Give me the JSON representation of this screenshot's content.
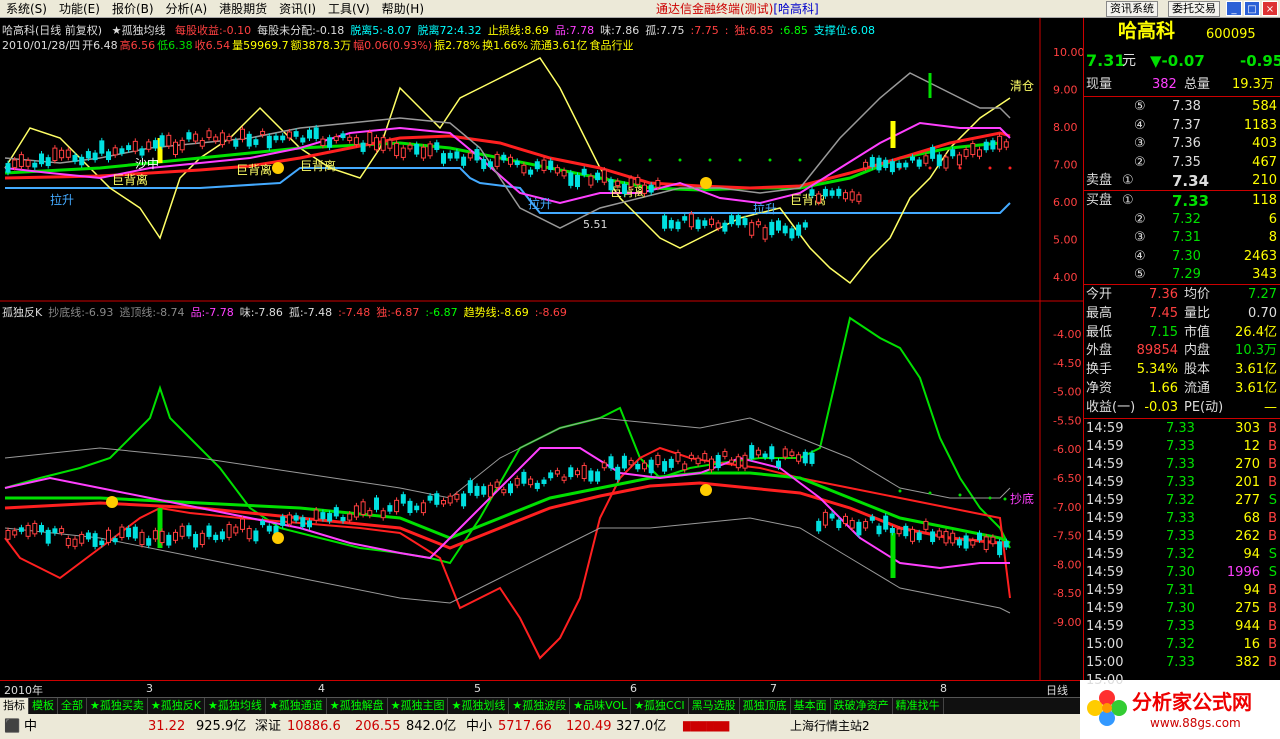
{
  "menu": {
    "items": [
      "系统(S)",
      "功能(E)",
      "报价(B)",
      "分析(A)",
      "港股期货",
      "资讯(I)",
      "工具(V)",
      "帮助(H)"
    ],
    "app_title": "通达信金融终端(测试)",
    "stock_title": "[哈高科]",
    "right_buttons": [
      "资讯系统",
      "委托交易"
    ],
    "window_buttons": [
      "_",
      "□",
      "×"
    ]
  },
  "top_chart": {
    "header": {
      "name": "哈高科(日线 前复权)",
      "indicator": "★孤独均线",
      "items": [
        {
          "text": "每股收益:-0.10",
          "color": "#ff4040"
        },
        {
          "text": "每股未分配:-0.18",
          "color": "#ddd"
        },
        {
          "text": "脱离5:-8.07",
          "color": "#00ffff"
        },
        {
          "text": "脱离72:4.32",
          "color": "#00ffff"
        },
        {
          "text": "止损线:8.69",
          "color": "#ffff00"
        },
        {
          "text": "品:7.78",
          "color": "#ff40ff"
        },
        {
          "text": "味:7.86",
          "color": "#ddd"
        },
        {
          "text": "孤:7.75",
          "color": "#ddd"
        },
        {
          "text": ":7.75",
          "color": "#ff4040"
        },
        {
          "text": ":",
          "color": "#ff4040"
        },
        {
          "text": "独:6.85",
          "color": "#ff4040"
        },
        {
          "text": ":6.85",
          "color": "#00ff00"
        },
        {
          "text": "支撑位:6.08",
          "color": "#00ffff"
        }
      ],
      "line2": [
        {
          "text": "2010/01/28/四",
          "color": "#ddd"
        },
        {
          "text": "开6.48",
          "color": "#ddd"
        },
        {
          "text": "高6.56",
          "color": "#ff4040"
        },
        {
          "text": "低6.38",
          "color": "#00e000"
        },
        {
          "text": "收6.54",
          "color": "#ff4040"
        },
        {
          "text": "量59969.7",
          "color": "#ffff00"
        },
        {
          "text": "额3878.3万",
          "color": "#ffff00"
        },
        {
          "text": "幅0.06(0.93%)",
          "color": "#ff4040"
        },
        {
          "text": "振2.78%",
          "color": "#ffff00"
        },
        {
          "text": "换1.66%",
          "color": "#ffff00"
        },
        {
          "text": "流通3.61亿",
          "color": "#ffff00"
        },
        {
          "text": "食品行业",
          "color": "#ffff00"
        }
      ]
    },
    "yaxis": [
      "10.00",
      "9.00",
      "8.00",
      "7.00",
      "6.00",
      "5.00",
      "4.00"
    ],
    "annotations": [
      "拉升",
      "沙中",
      "巨背离",
      "巨背离",
      "巨背离",
      "拉升",
      "巨背离",
      "巨背离",
      "拉升",
      "清仓",
      "5.51"
    ]
  },
  "bottom_chart": {
    "header": [
      {
        "text": "孤独反K",
        "color": "#ddd"
      },
      {
        "text": "抄底线:-6.93",
        "color": "#888"
      },
      {
        "text": "逃顶线:-8.74",
        "color": "#888"
      },
      {
        "text": "品:-7.78",
        "color": "#ff40ff"
      },
      {
        "text": "味:-7.86",
        "color": "#ddd"
      },
      {
        "text": "孤:-7.48",
        "color": "#ddd"
      },
      {
        "text": ":-7.48",
        "color": "#ff4040"
      },
      {
        "text": "独:-6.87",
        "color": "#ff4040"
      },
      {
        "text": ":-6.87",
        "color": "#00ff00"
      },
      {
        "text": "趋势线:-8.69",
        "color": "#ffff00"
      },
      {
        "text": ":-8.69",
        "color": "#ff4040"
      }
    ],
    "yaxis": [
      "-4.00",
      "-4.50",
      "-5.00",
      "-5.50",
      "-6.00",
      "-6.50",
      "-7.00",
      "-7.50",
      "-8.00",
      "-8.50",
      "-9.00"
    ],
    "annotations": [
      "抄底"
    ]
  },
  "xaxis": {
    "labels": [
      "2010年",
      "3",
      "4",
      "5",
      "6",
      "7",
      "8"
    ],
    "period": "日线"
  },
  "quote": {
    "name": "哈高科",
    "code": "600095",
    "price": "7.31",
    "unit": "元",
    "change": "▼-0.07",
    "change_pct": "-0.95",
    "now_vol_label": "现量",
    "now_vol": "382",
    "total_vol_label": "总量",
    "total_vol": "19.3万",
    "sells": [
      {
        "idx": "⑤",
        "price": "7.38",
        "vol": "584"
      },
      {
        "idx": "④",
        "price": "7.37",
        "vol": "1183"
      },
      {
        "idx": "③",
        "price": "7.36",
        "vol": "403"
      },
      {
        "idx": "②",
        "price": "7.35",
        "vol": "467"
      },
      {
        "idx": "①",
        "price": "7.34",
        "vol": "210",
        "label": "卖盘"
      }
    ],
    "buys": [
      {
        "idx": "①",
        "price": "7.33",
        "vol": "118",
        "label": "买盘"
      },
      {
        "idx": "②",
        "price": "7.32",
        "vol": "6"
      },
      {
        "idx": "③",
        "price": "7.31",
        "vol": "8"
      },
      {
        "idx": "④",
        "price": "7.30",
        "vol": "2463"
      },
      {
        "idx": "⑤",
        "price": "7.29",
        "vol": "343"
      }
    ],
    "stats": [
      {
        "l1": "今开",
        "v1": "7.36",
        "c1": "#ff4040",
        "l2": "均价",
        "v2": "7.27",
        "c2": "#00e000"
      },
      {
        "l1": "最高",
        "v1": "7.45",
        "c1": "#ff4040",
        "l2": "量比",
        "v2": "0.70",
        "c2": "#ddd"
      },
      {
        "l1": "最低",
        "v1": "7.15",
        "c1": "#00e000",
        "l2": "市值",
        "v2": "26.4亿",
        "c2": "#ffff00"
      },
      {
        "l1": "外盘",
        "v1": "89854",
        "c1": "#ff4040",
        "l2": "内盘",
        "v2": "10.3万",
        "c2": "#00e000"
      },
      {
        "l1": "换手",
        "v1": "5.34%",
        "c1": "#ffff00",
        "l2": "股本",
        "v2": "3.61亿",
        "c2": "#ffff00"
      },
      {
        "l1": "净资",
        "v1": "1.66",
        "c1": "#ffff00",
        "l2": "流通",
        "v2": "3.61亿",
        "c2": "#ffff00"
      },
      {
        "l1": "收益(一)",
        "v1": "-0.03",
        "c1": "#ffff00",
        "l2": "PE(动)",
        "v2": "—",
        "c2": "#ffff00"
      }
    ],
    "ticks": [
      {
        "time": "14:59",
        "price": "7.33",
        "vol": "303",
        "dir": "B"
      },
      {
        "time": "14:59",
        "price": "7.33",
        "vol": "12",
        "dir": "B"
      },
      {
        "time": "14:59",
        "price": "7.33",
        "vol": "270",
        "dir": "B"
      },
      {
        "time": "14:59",
        "price": "7.33",
        "vol": "201",
        "dir": "B"
      },
      {
        "time": "14:59",
        "price": "7.32",
        "vol": "277",
        "dir": "S"
      },
      {
        "time": "14:59",
        "price": "7.33",
        "vol": "68",
        "dir": "B"
      },
      {
        "time": "14:59",
        "price": "7.33",
        "vol": "262",
        "dir": "B"
      },
      {
        "time": "14:59",
        "price": "7.32",
        "vol": "94",
        "dir": "S"
      },
      {
        "time": "14:59",
        "price": "7.30",
        "vol": "1996",
        "dir": "S"
      },
      {
        "time": "14:59",
        "price": "7.31",
        "vol": "94",
        "dir": "B"
      },
      {
        "time": "14:59",
        "price": "7.30",
        "vol": "275",
        "dir": "B"
      },
      {
        "time": "14:59",
        "price": "7.33",
        "vol": "944",
        "dir": "B"
      },
      {
        "time": "15:00",
        "price": "7.32",
        "vol": "16",
        "dir": "B"
      },
      {
        "time": "15:00",
        "price": "7.33",
        "vol": "382",
        "dir": "B"
      },
      {
        "time": "15:00",
        "price": "",
        "vol": "",
        "dir": ""
      }
    ]
  },
  "tabs": [
    "指标",
    "模板",
    "全部",
    "★孤独买卖",
    "★孤独反K",
    "★孤独均线",
    "★孤独通道",
    "★孤独解盘",
    "★孤独主图",
    "★孤独划线",
    "★孤独波段",
    "★品味VOL",
    "★孤独CCI",
    "黑马选股",
    "孤独顶底",
    "基本面",
    "跌破净资产",
    "精准找牛"
  ],
  "status": {
    "sh_label": "中",
    "sh_pts": "31.22",
    "sh_amt": "925.9亿",
    "sz_label": "深证",
    "sz_idx": "10886.6",
    "sz_pts": "206.55",
    "sz_amt": "842.0亿",
    "zx_label": "中小",
    "zx_idx": "5717.66",
    "zx_pts": "120.49",
    "zx_amt": "327.0亿",
    "server": "上海行情主站2"
  },
  "logo": {
    "name": "分析家公式网",
    "url": "www.88gs.com"
  }
}
